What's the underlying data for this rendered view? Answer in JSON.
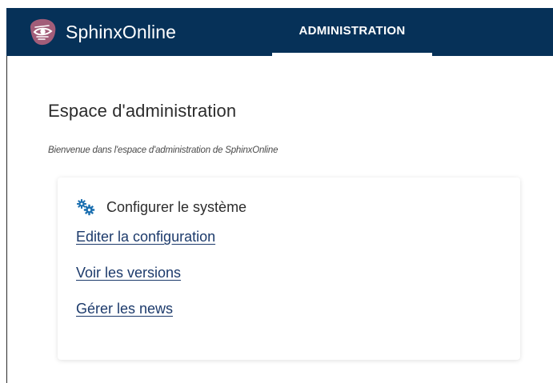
{
  "header": {
    "brand_name": "SphinxOnline",
    "active_tab": "ADMINISTRATION",
    "logo_icon": "sphinx-eye-logo",
    "colors": {
      "bar": "#063158",
      "logo_bg": "#a25d79",
      "text": "#ffffff"
    }
  },
  "main": {
    "title": "Espace d'administration",
    "subtitle": "Bienvenue dans l'espace d'administration de SphinxOnline"
  },
  "card": {
    "icon": "gears-icon",
    "title": "Configurer le système",
    "links": [
      "Editer la configuration",
      "Voir les versions",
      "Gérer les news"
    ],
    "colors": {
      "icon": "#1b6fb0",
      "link": "#1c3a6b"
    }
  }
}
